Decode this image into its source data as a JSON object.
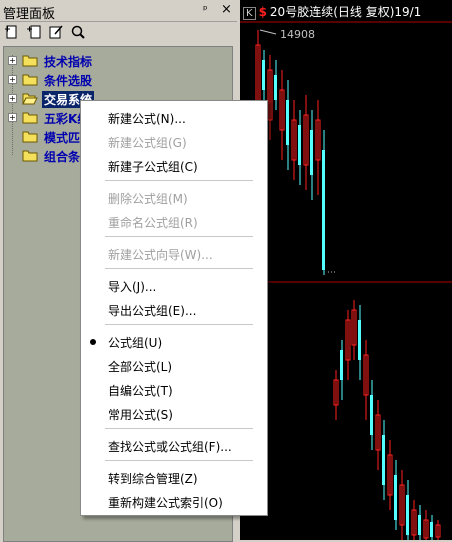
{
  "panel": {
    "title": "管理面板",
    "pin_glyph": "ᵖ",
    "close_glyph": "×",
    "toolbar": [
      "new-formula-icon",
      "new-group-icon",
      "edit-icon",
      "search-icon"
    ]
  },
  "tree": {
    "items": [
      {
        "label": "技术指标",
        "expanded": false
      },
      {
        "label": "条件选股",
        "expanded": false
      },
      {
        "label": "交易系统",
        "expanded": false,
        "selected": true
      },
      {
        "label": "五彩K线",
        "expanded": false
      },
      {
        "label": "模式匹配"
      },
      {
        "label": "组合条件"
      }
    ]
  },
  "chart": {
    "k_badge": "K",
    "s_badge": "$",
    "title": "20号胶连续(日线 复权)19/1",
    "price_label": "14908",
    "dots_label": "…"
  },
  "menu": {
    "items": [
      {
        "label": "新建公式(N)...",
        "disabled": false
      },
      {
        "label": "新建公式组(G)",
        "disabled": true
      },
      {
        "label": "新建子公式组(C)",
        "disabled": false
      },
      {
        "label": "删除公式组(M)",
        "disabled": true
      },
      {
        "label": "重命名公式组(R)",
        "disabled": true
      },
      {
        "label": "新建公式向导(W)...",
        "disabled": true
      },
      {
        "label": "导入(J)...",
        "disabled": false
      },
      {
        "label": "导出公式组(E)...",
        "disabled": false
      },
      {
        "label": "公式组(U)",
        "disabled": false,
        "checked": true
      },
      {
        "label": "全部公式(L)",
        "disabled": false
      },
      {
        "label": "自编公式(T)",
        "disabled": false
      },
      {
        "label": "常用公式(S)",
        "disabled": false
      },
      {
        "label": "查找公式或公式组(F)...",
        "disabled": false
      },
      {
        "label": "转到综合管理(Z)",
        "disabled": false
      },
      {
        "label": "重新构建公式索引(O)",
        "disabled": false
      }
    ]
  },
  "colors": {
    "tree_bg": "#a7ab9b",
    "link_blue": "#0000b0",
    "selection": "#0a246a",
    "candle_up": "#ff2020",
    "candle_down": "#54ffff"
  }
}
